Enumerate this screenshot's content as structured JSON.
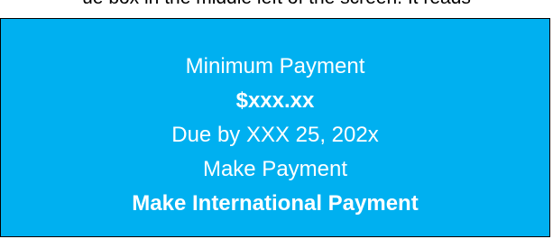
{
  "top_text": "ue box in the middle left of the screen. It reads",
  "payment_panel": {
    "minimum_payment_label": "Minimum Payment",
    "amount": "$xxx.xx",
    "due_text": "Due by XXX 25, 202x",
    "make_payment_label": "Make Payment",
    "make_international_payment_label": "Make International Payment",
    "background_color": "#00B0F0",
    "text_color": "#FFFFFF"
  }
}
